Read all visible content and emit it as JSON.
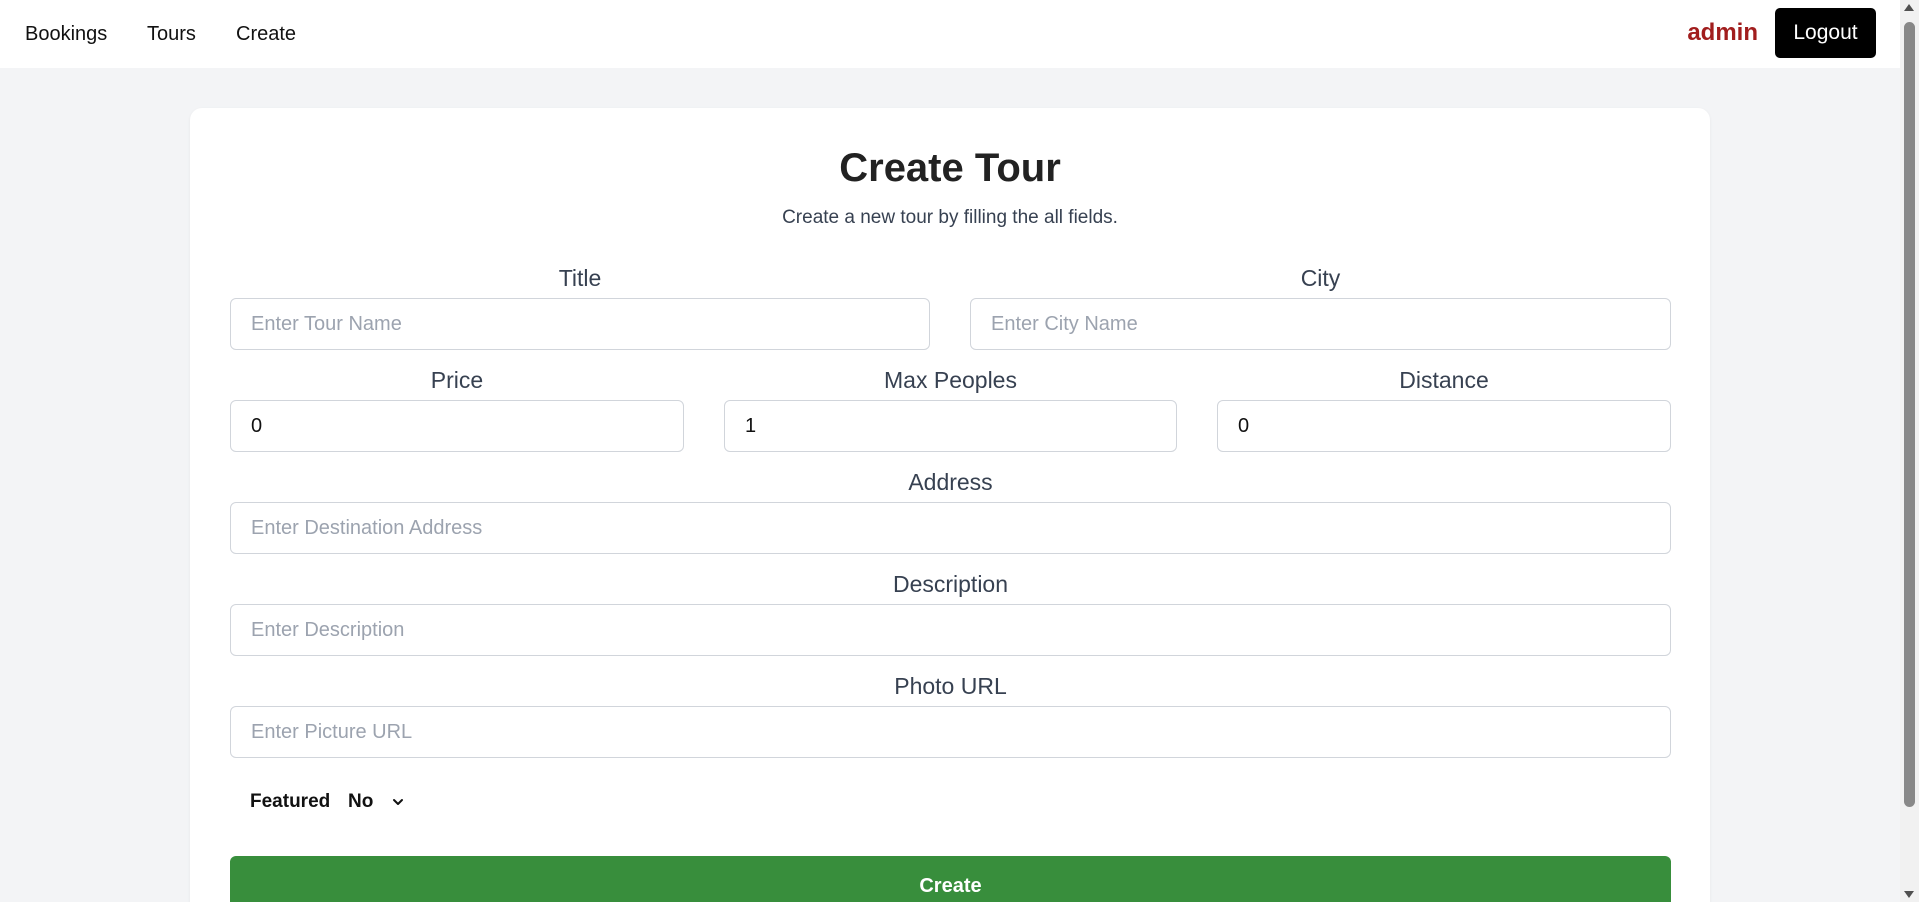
{
  "nav": {
    "links": [
      "Bookings",
      "Tours",
      "Create"
    ],
    "user": "admin",
    "logout_label": "Logout"
  },
  "form": {
    "title": "Create Tour",
    "subtitle": "Create a new tour by filling the all fields.",
    "title_field": {
      "label": "Title",
      "placeholder": "Enter Tour Name",
      "value": ""
    },
    "city_field": {
      "label": "City",
      "placeholder": "Enter City Name",
      "value": ""
    },
    "price_field": {
      "label": "Price",
      "value": "0"
    },
    "max_people_field": {
      "label": "Max Peoples",
      "value": "1"
    },
    "distance_field": {
      "label": "Distance",
      "value": "0"
    },
    "address_field": {
      "label": "Address",
      "placeholder": "Enter Destination Address",
      "value": ""
    },
    "description_field": {
      "label": "Description",
      "placeholder": "Enter Description",
      "value": ""
    },
    "photo_field": {
      "label": "Photo URL",
      "placeholder": "Enter Picture URL",
      "value": ""
    },
    "featured": {
      "label": "Featured",
      "selected": "No"
    },
    "submit_label": "Create"
  },
  "colors": {
    "accent_user": "#a11d1d",
    "submit_button": "#388e3c",
    "logout_button": "#000000",
    "background": "#f3f4f6"
  }
}
